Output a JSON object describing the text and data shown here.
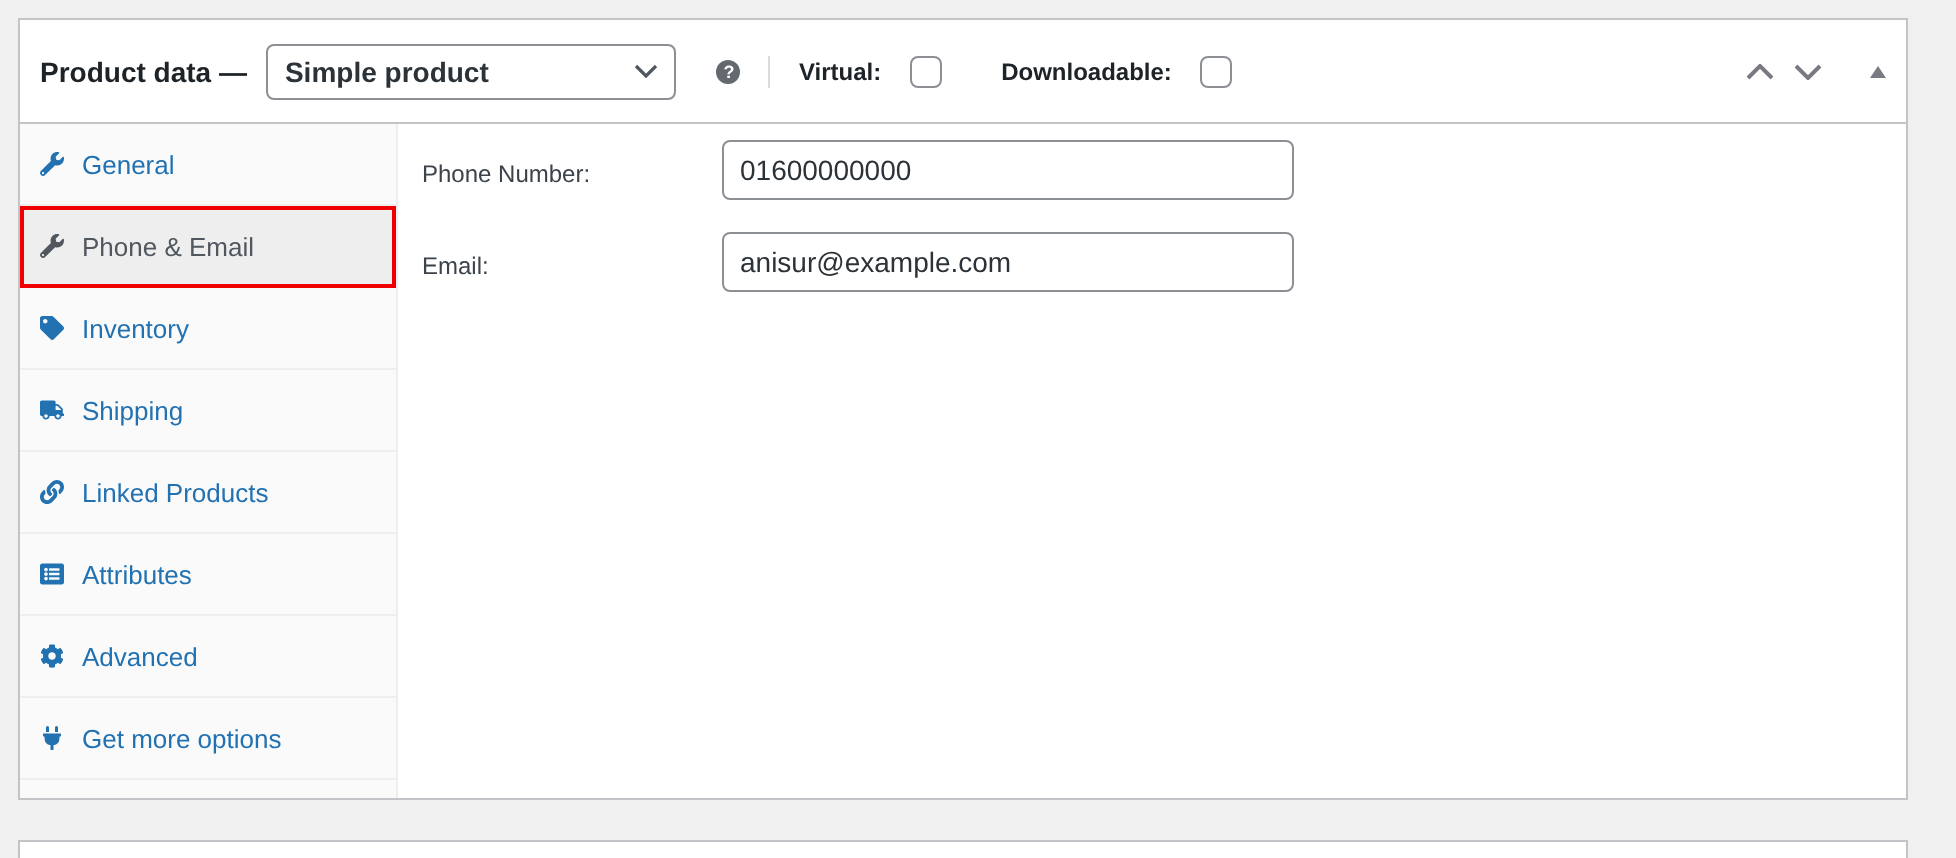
{
  "panel": {
    "title": "Product data —",
    "product_type": "Simple product",
    "help": "?",
    "options": [
      {
        "label": "Virtual:",
        "checked": false
      },
      {
        "label": "Downloadable:",
        "checked": false
      }
    ]
  },
  "tabs": [
    {
      "label": "General",
      "selected": false
    },
    {
      "label": "Phone & Email",
      "selected": true
    },
    {
      "label": "Inventory",
      "selected": false
    },
    {
      "label": "Shipping",
      "selected": false
    },
    {
      "label": "Linked Products",
      "selected": false
    },
    {
      "label": "Attributes",
      "selected": false
    },
    {
      "label": "Advanced",
      "selected": false
    },
    {
      "label": "Get more options",
      "selected": false
    }
  ],
  "fields": [
    {
      "label": "Phone Number:",
      "value": "01600000000"
    },
    {
      "label": "Email:",
      "value": "anisur@example.com"
    }
  ]
}
